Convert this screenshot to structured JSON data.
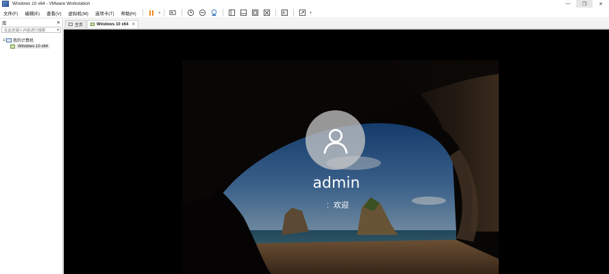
{
  "window": {
    "title": "Windows 10 x64 - VMware Workstation",
    "controls": {
      "minimize": "—",
      "maximize": "❐",
      "close": "✕"
    }
  },
  "menu": {
    "items": [
      {
        "label": "文件(F)"
      },
      {
        "label": "编辑(E)"
      },
      {
        "label": "查看(V)"
      },
      {
        "label": "虚拟机(M)"
      },
      {
        "label": "选项卡(T)"
      },
      {
        "label": "帮助(H)"
      }
    ]
  },
  "toolbar": {
    "accent": "#f08a1c",
    "icons": [
      "pause-icon",
      "send-ctrl-alt-del-icon",
      "snapshot-icon",
      "revert-snapshot-icon",
      "manage-snapshots-icon",
      "show-library-icon",
      "thumbnail-bar-icon",
      "full-screen-icon",
      "unity-icon",
      "console-view-icon",
      "stretch-guest-icon"
    ]
  },
  "library": {
    "header": "库",
    "close": "✕",
    "search_placeholder": "在此处键入内容进行搜索",
    "tree": {
      "root": "我的计算机",
      "children": [
        "Windows 10 x64"
      ]
    }
  },
  "tabs": [
    {
      "label": "主页",
      "active": false
    },
    {
      "label": "Windows 10 x64",
      "active": true,
      "close": "✕"
    }
  ],
  "guest": {
    "username": "admin",
    "status": "欢迎",
    "avatar_icon": "user-icon"
  }
}
